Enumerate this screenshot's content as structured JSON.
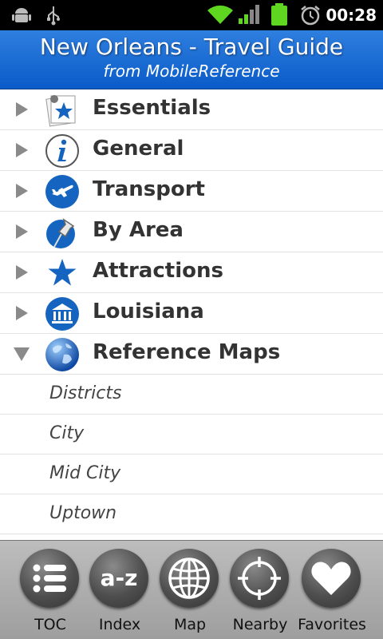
{
  "status_bar": {
    "time": "00:28",
    "icons": [
      "android-debug-icon",
      "usb-icon",
      "wifi-icon",
      "signal-icon",
      "battery-icon",
      "alarm-icon"
    ]
  },
  "header": {
    "title": "New Orleans - Travel Guide",
    "subtitle": "from MobileReference"
  },
  "toc": {
    "items": [
      {
        "label": "Essentials",
        "icon": "essentials-icon",
        "expanded": false
      },
      {
        "label": "General",
        "icon": "info-icon",
        "expanded": false
      },
      {
        "label": "Transport",
        "icon": "airplane-icon",
        "expanded": false
      },
      {
        "label": "By Area",
        "icon": "pushpin-icon",
        "expanded": false
      },
      {
        "label": "Attractions",
        "icon": "star-icon",
        "expanded": false
      },
      {
        "label": "Louisiana",
        "icon": "museum-icon",
        "expanded": false
      },
      {
        "label": "Reference Maps",
        "icon": "globe-icon",
        "expanded": true
      }
    ],
    "subitems": [
      "Districts",
      "City",
      "Mid City",
      "Uptown"
    ]
  },
  "toolbar": {
    "toc_label": "TOC",
    "index_label": "Index",
    "index_icon_text": "a-z",
    "map_label": "Map",
    "nearby_label": "Nearby",
    "favorites_label": "Favorites"
  },
  "colors": {
    "header_blue": "#0a5bc8",
    "icon_blue": "#1565c0",
    "toolbar_gray": "#a8a8a8"
  }
}
